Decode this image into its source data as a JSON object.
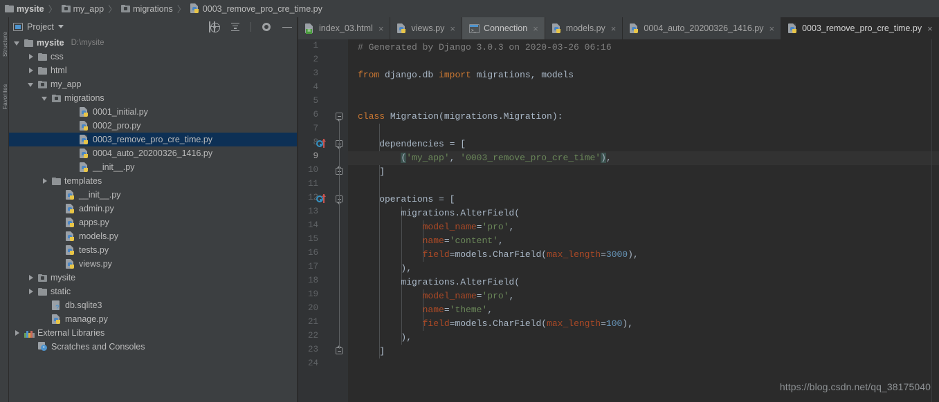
{
  "breadcrumb": {
    "items": [
      {
        "label": "mysite",
        "icon": "folder-icon",
        "bold": true
      },
      {
        "label": "my_app",
        "icon": "module-folder-icon",
        "bold": false
      },
      {
        "label": "migrations",
        "icon": "module-folder-icon",
        "bold": false
      },
      {
        "label": "0003_remove_pro_cre_time.py",
        "icon": "python-file-icon",
        "bold": false
      }
    ],
    "separator": "〉"
  },
  "left_strip": {
    "tabs": [
      "Structure",
      "Favorites"
    ]
  },
  "project_panel": {
    "title": "Project",
    "caret": "chevron-down-icon",
    "toolbar": [
      {
        "name": "locate-icon",
        "tooltip": "Select Opened File"
      },
      {
        "name": "collapse-all-icon",
        "tooltip": "Collapse All"
      },
      {
        "name": "gear-icon",
        "tooltip": "Settings"
      },
      {
        "name": "minimize-icon",
        "tooltip": "Hide"
      }
    ],
    "tree": [
      {
        "label": "mysite",
        "sub": "D:\\mysite",
        "icon": "folder-icon",
        "arrow": "down",
        "depth": 0,
        "bold": true,
        "selected": false
      },
      {
        "label": "css",
        "sub": "",
        "icon": "folder-icon",
        "arrow": "right",
        "depth": 1,
        "bold": false,
        "selected": false
      },
      {
        "label": "html",
        "sub": "",
        "icon": "folder-icon",
        "arrow": "right",
        "depth": 1,
        "bold": false,
        "selected": false
      },
      {
        "label": "my_app",
        "sub": "",
        "icon": "module-folder-icon",
        "arrow": "down",
        "depth": 1,
        "bold": false,
        "selected": false
      },
      {
        "label": "migrations",
        "sub": "",
        "icon": "module-folder-icon",
        "arrow": "down",
        "depth": 2,
        "bold": false,
        "selected": false
      },
      {
        "label": "0001_initial.py",
        "sub": "",
        "icon": "python-file-icon",
        "arrow": "none",
        "depth": 4,
        "bold": false,
        "selected": false
      },
      {
        "label": "0002_pro.py",
        "sub": "",
        "icon": "python-file-icon",
        "arrow": "none",
        "depth": 4,
        "bold": false,
        "selected": false
      },
      {
        "label": "0003_remove_pro_cre_time.py",
        "sub": "",
        "icon": "python-file-icon",
        "arrow": "none",
        "depth": 4,
        "bold": false,
        "selected": true
      },
      {
        "label": "0004_auto_20200326_1416.py",
        "sub": "",
        "icon": "python-file-icon",
        "arrow": "none",
        "depth": 4,
        "bold": false,
        "selected": false
      },
      {
        "label": "__init__.py",
        "sub": "",
        "icon": "python-file-icon",
        "arrow": "none",
        "depth": 4,
        "bold": false,
        "selected": false
      },
      {
        "label": "templates",
        "sub": "",
        "icon": "folder-icon",
        "arrow": "right",
        "depth": 2,
        "bold": false,
        "selected": false
      },
      {
        "label": "__init__.py",
        "sub": "",
        "icon": "python-file-icon",
        "arrow": "none",
        "depth": 3,
        "bold": false,
        "selected": false
      },
      {
        "label": "admin.py",
        "sub": "",
        "icon": "python-file-icon",
        "arrow": "none",
        "depth": 3,
        "bold": false,
        "selected": false
      },
      {
        "label": "apps.py",
        "sub": "",
        "icon": "python-file-icon",
        "arrow": "none",
        "depth": 3,
        "bold": false,
        "selected": false
      },
      {
        "label": "models.py",
        "sub": "",
        "icon": "python-file-icon",
        "arrow": "none",
        "depth": 3,
        "bold": false,
        "selected": false
      },
      {
        "label": "tests.py",
        "sub": "",
        "icon": "python-file-icon",
        "arrow": "none",
        "depth": 3,
        "bold": false,
        "selected": false
      },
      {
        "label": "views.py",
        "sub": "",
        "icon": "python-file-icon",
        "arrow": "none",
        "depth": 3,
        "bold": false,
        "selected": false
      },
      {
        "label": "mysite",
        "sub": "",
        "icon": "module-folder-icon",
        "arrow": "right",
        "depth": 1,
        "bold": false,
        "selected": false
      },
      {
        "label": "static",
        "sub": "",
        "icon": "folder-icon",
        "arrow": "right",
        "depth": 1,
        "bold": false,
        "selected": false
      },
      {
        "label": "db.sqlite3",
        "sub": "",
        "icon": "unknown-file-icon",
        "arrow": "none",
        "depth": 2,
        "bold": false,
        "selected": false
      },
      {
        "label": "manage.py",
        "sub": "",
        "icon": "python-file-icon",
        "arrow": "none",
        "depth": 2,
        "bold": false,
        "selected": false
      },
      {
        "label": "External Libraries",
        "sub": "",
        "icon": "external-libraries-icon",
        "arrow": "right",
        "depth": 0,
        "bold": false,
        "selected": false
      },
      {
        "label": "Scratches and Consoles",
        "sub": "",
        "icon": "scratches-icon",
        "arrow": "none",
        "depth": 1,
        "bold": false,
        "selected": false
      }
    ]
  },
  "editor": {
    "tabs": [
      {
        "label": "index_03.html",
        "icon": "html-file-icon",
        "state": "normal",
        "close": "×"
      },
      {
        "label": "views.py",
        "icon": "python-file-icon",
        "state": "normal",
        "close": "×"
      },
      {
        "label": "Connection",
        "icon": "connection-icon",
        "state": "hover",
        "close": "×"
      },
      {
        "label": "models.py",
        "icon": "python-file-icon",
        "state": "normal",
        "close": "×"
      },
      {
        "label": "0004_auto_20200326_1416.py",
        "icon": "python-file-icon",
        "state": "normal",
        "close": "×"
      },
      {
        "label": "0003_remove_pro_cre_time.py",
        "icon": "python-file-icon",
        "state": "active",
        "close": "×"
      }
    ],
    "line_numbers": [
      1,
      2,
      3,
      4,
      5,
      6,
      7,
      8,
      9,
      10,
      11,
      12,
      13,
      14,
      15,
      16,
      17,
      18,
      19,
      20,
      21,
      22,
      23,
      24
    ],
    "current_line": 9,
    "gutter_markers": [
      {
        "line": 8,
        "type": "overriding-member-icon"
      },
      {
        "line": 12,
        "type": "overriding-member-icon"
      }
    ],
    "fold_markers": [
      {
        "line": 6,
        "kind": "start"
      },
      {
        "line": 8,
        "kind": "start"
      },
      {
        "line": 10,
        "kind": "end"
      },
      {
        "line": 12,
        "kind": "start"
      },
      {
        "line": 23,
        "kind": "end"
      }
    ],
    "code_lines": [
      {
        "n": 1,
        "tokens": [
          {
            "t": "# Generated by Django 3.0.3 on 2020-03-26 06:16",
            "c": "cmt"
          }
        ]
      },
      {
        "n": 2,
        "tokens": []
      },
      {
        "n": 3,
        "tokens": [
          {
            "t": "from",
            "c": "kw"
          },
          {
            "t": " django.db ",
            "c": "ident"
          },
          {
            "t": "import",
            "c": "kw"
          },
          {
            "t": " migrations, models",
            "c": "ident"
          }
        ]
      },
      {
        "n": 4,
        "tokens": []
      },
      {
        "n": 5,
        "tokens": []
      },
      {
        "n": 6,
        "tokens": [
          {
            "t": "class",
            "c": "kw"
          },
          {
            "t": " Migration(migrations.Migration):",
            "c": "ident"
          }
        ]
      },
      {
        "n": 7,
        "tokens": []
      },
      {
        "n": 8,
        "tokens": [
          {
            "t": "    dependencies = [",
            "c": "ident"
          }
        ]
      },
      {
        "n": 9,
        "tokens": [
          {
            "t": "        ",
            "c": "ident"
          },
          {
            "t": "(",
            "c": "pm"
          },
          {
            "t": "'my_app'",
            "c": "str"
          },
          {
            "t": ", ",
            "c": "ident"
          },
          {
            "t": "'0003_remove_pro_cre_time'",
            "c": "str"
          },
          {
            "t": ")",
            "c": "pm"
          },
          {
            "t": ",",
            "c": "ident"
          }
        ]
      },
      {
        "n": 10,
        "tokens": [
          {
            "t": "    ]",
            "c": "ident"
          }
        ]
      },
      {
        "n": 11,
        "tokens": []
      },
      {
        "n": 12,
        "tokens": [
          {
            "t": "    operations = [",
            "c": "ident"
          }
        ]
      },
      {
        "n": 13,
        "tokens": [
          {
            "t": "        migrations.AlterField(",
            "c": "ident"
          }
        ]
      },
      {
        "n": 14,
        "tokens": [
          {
            "t": "            ",
            "c": "ident"
          },
          {
            "t": "model_name",
            "c": "kwarg"
          },
          {
            "t": "=",
            "c": "ident"
          },
          {
            "t": "'pro'",
            "c": "str"
          },
          {
            "t": ",",
            "c": "ident"
          }
        ]
      },
      {
        "n": 15,
        "tokens": [
          {
            "t": "            ",
            "c": "ident"
          },
          {
            "t": "name",
            "c": "kwarg"
          },
          {
            "t": "=",
            "c": "ident"
          },
          {
            "t": "'content'",
            "c": "str"
          },
          {
            "t": ",",
            "c": "ident"
          }
        ]
      },
      {
        "n": 16,
        "tokens": [
          {
            "t": "            ",
            "c": "ident"
          },
          {
            "t": "field",
            "c": "kwarg"
          },
          {
            "t": "=models.CharField(",
            "c": "ident"
          },
          {
            "t": "max_length",
            "c": "kwarg"
          },
          {
            "t": "=",
            "c": "ident"
          },
          {
            "t": "3000",
            "c": "num"
          },
          {
            "t": "),",
            "c": "ident"
          }
        ]
      },
      {
        "n": 17,
        "tokens": [
          {
            "t": "        ),",
            "c": "ident"
          }
        ]
      },
      {
        "n": 18,
        "tokens": [
          {
            "t": "        migrations.AlterField(",
            "c": "ident"
          }
        ]
      },
      {
        "n": 19,
        "tokens": [
          {
            "t": "            ",
            "c": "ident"
          },
          {
            "t": "model_name",
            "c": "kwarg"
          },
          {
            "t": "=",
            "c": "ident"
          },
          {
            "t": "'pro'",
            "c": "str"
          },
          {
            "t": ",",
            "c": "ident"
          }
        ]
      },
      {
        "n": 20,
        "tokens": [
          {
            "t": "            ",
            "c": "ident"
          },
          {
            "t": "name",
            "c": "kwarg"
          },
          {
            "t": "=",
            "c": "ident"
          },
          {
            "t": "'theme'",
            "c": "str"
          },
          {
            "t": ",",
            "c": "ident"
          }
        ]
      },
      {
        "n": 21,
        "tokens": [
          {
            "t": "            ",
            "c": "ident"
          },
          {
            "t": "field",
            "c": "kwarg"
          },
          {
            "t": "=models.CharField(",
            "c": "ident"
          },
          {
            "t": "max_length",
            "c": "kwarg"
          },
          {
            "t": "=",
            "c": "ident"
          },
          {
            "t": "100",
            "c": "num"
          },
          {
            "t": "),",
            "c": "ident"
          }
        ]
      },
      {
        "n": 22,
        "tokens": [
          {
            "t": "        ),",
            "c": "ident"
          }
        ]
      },
      {
        "n": 23,
        "tokens": [
          {
            "t": "    ]",
            "c": "ident"
          }
        ]
      },
      {
        "n": 24,
        "tokens": []
      }
    ]
  },
  "watermark": "https://blog.csdn.net/qq_38175040",
  "colors": {
    "panel_bg": "#3c3f41",
    "editor_bg": "#2b2b2b",
    "gutter_bg": "#313335",
    "selection": "#0d3055",
    "current_line": "#323232",
    "keyword": "#cc7832",
    "string": "#6a8759",
    "comment": "#808080",
    "number": "#6897bb",
    "kwarg": "#aa4926",
    "text": "#a9b7c6",
    "accent_blue": "#4e94ce"
  }
}
